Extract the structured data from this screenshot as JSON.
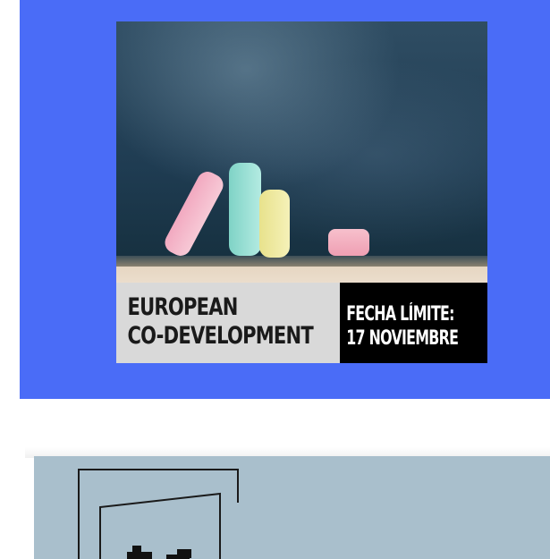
{
  "promo": {
    "title_line1": "EUROPEAN",
    "title_line2": "CO-DEVELOPMENT",
    "deadline_line1": "FECHA LÍMITE:",
    "deadline_line2": "17 NOVIEMBRE"
  },
  "colors": {
    "card_bg": "#4a6cf7",
    "second_card_bg": "#a9bfcc",
    "label_left_bg": "#d9d9d9",
    "label_right_bg": "#000000"
  },
  "icons": {
    "chalkboard_image": "chalkboard-photo",
    "second_card_logo": "building-logo"
  }
}
